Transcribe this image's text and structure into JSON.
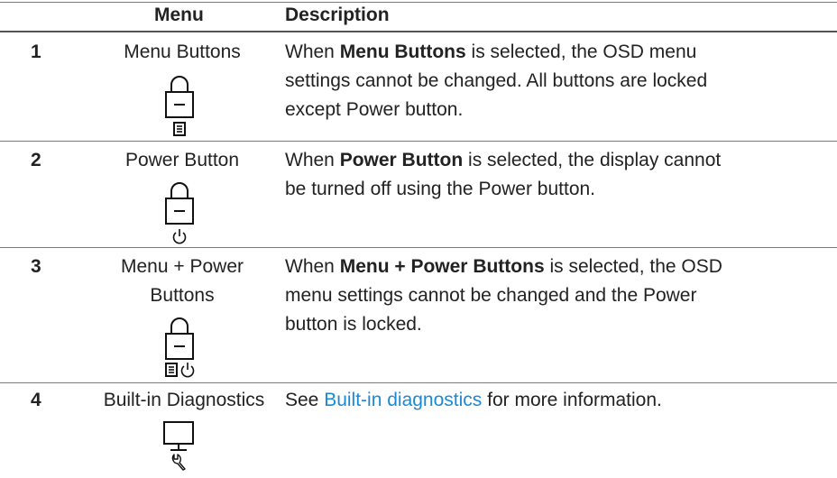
{
  "header": {
    "menu": "Menu",
    "description": "Description"
  },
  "rows": [
    {
      "number": "1",
      "menu": "Menu Buttons",
      "desc_pre": "When ",
      "desc_bold": "Menu Buttons",
      "desc_post_1": " is selected, the OSD menu",
      "desc_line_2": "settings cannot be changed. All buttons are locked",
      "desc_line_3": "except Power button.",
      "icons": [
        "lock-icon",
        "menu-icon"
      ]
    },
    {
      "number": "2",
      "menu": "Power Button",
      "desc_pre": "When ",
      "desc_bold": "Power Button",
      "desc_post_1": " is selected, the display cannot",
      "desc_line_2": "be turned off using the Power button.",
      "icons": [
        "lock-icon",
        "power-icon"
      ]
    },
    {
      "number": "3",
      "menu_line_1": "Menu + Power",
      "menu_line_2": "Buttons",
      "desc_pre": "When ",
      "desc_bold": "Menu + Power Buttons",
      "desc_post_1": " is selected, the OSD",
      "desc_line_2": "menu settings cannot be changed and the Power",
      "desc_line_3": "button is locked.",
      "icons": [
        "lock-icon",
        "menu-icon",
        "power-icon"
      ]
    },
    {
      "number": "4",
      "menu": "Built-in Diagnostics",
      "desc_pre": "See ",
      "desc_link": "Built-in diagnostics",
      "desc_post_1": " for more information.",
      "icons": [
        "monitor-icon",
        "wrench-icon"
      ]
    }
  ],
  "colors": {
    "link": "#1a8ad6",
    "text": "#222222",
    "rule": "#7a7a7a"
  }
}
